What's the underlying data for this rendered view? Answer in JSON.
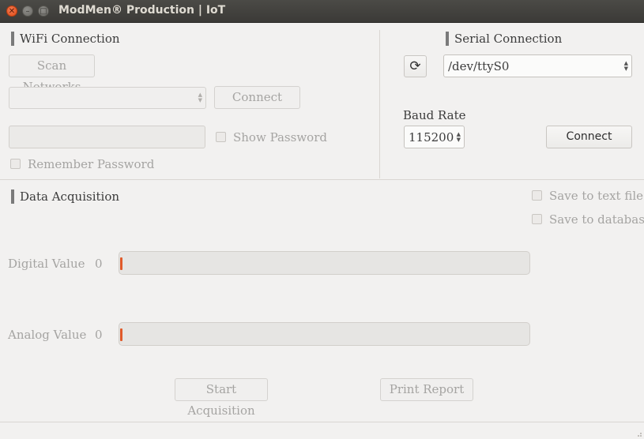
{
  "window": {
    "title": "ModMen® Production | IoT"
  },
  "wifi": {
    "title": "WiFi Connection",
    "scan_label": "Scan Networks",
    "network_value": "",
    "connect_label": "Connect",
    "password_value": "",
    "show_password_label": "Show Password",
    "remember_label": "Remember Password"
  },
  "serial": {
    "title": "Serial Connection",
    "port_value": "/dev/ttyS0",
    "baud_label": "Baud Rate",
    "baud_value": "115200",
    "connect_label": "Connect"
  },
  "acquisition": {
    "title": "Data Acquisition",
    "save_text_label": "Save to text file",
    "save_db_label": "Save to database",
    "digital_label": "Digital Value",
    "digital_value": "0",
    "digital_progress": 0,
    "analog_label": "Analog Value",
    "analog_value": "0",
    "analog_progress": 0,
    "start_label": "Start Acquisition",
    "print_label": "Print Report"
  },
  "colors": {
    "progress_accent": "#e05a2a",
    "close_button": "#df4b16",
    "titlebar": "#3b3a37"
  },
  "icons": {
    "close": "close-icon",
    "minimize": "minimize-icon",
    "maximize": "maximize-icon",
    "refresh": "refresh-icon",
    "combo_arrows": "chevron-updown-icon"
  }
}
